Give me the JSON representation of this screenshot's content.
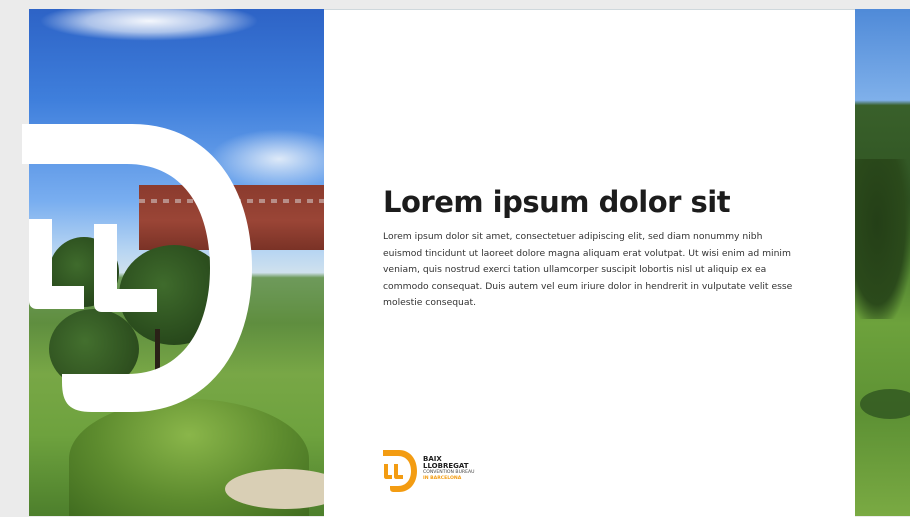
{
  "card": {
    "heading": "Lorem ipsum dolor sit",
    "body": "Lorem ipsum dolor sit amet, consectetuer adipiscing elit, sed diam nonummy nibh euismod tincidunt ut laoreet dolore magna aliquam erat volutpat. Ut wisi enim ad minim veniam, quis nostrud exerci tation ullamcorper suscipit lobortis nisl ut aliquip ex ea commodo consequat. Duis autem vel eum iriure dolor in hendrerit in vulputate velit esse molestie consequat."
  },
  "brand": {
    "line1": "BAIX",
    "line2": "LLOBREGAT",
    "line3": "CONVENTION BUREAU",
    "line4": "IN BARCELONA",
    "logo_letters": "LL",
    "accent_color": "#f39c12"
  },
  "colors": {
    "background": "#ebebeb",
    "card": "#ffffff",
    "heading": "#1c1c1c",
    "text": "#333333",
    "logo_overlay": "#ffffff"
  },
  "icons": {
    "logo_overlay": "llb-logo-mark-icon",
    "brand_logo": "llb-brand-logo-icon"
  }
}
